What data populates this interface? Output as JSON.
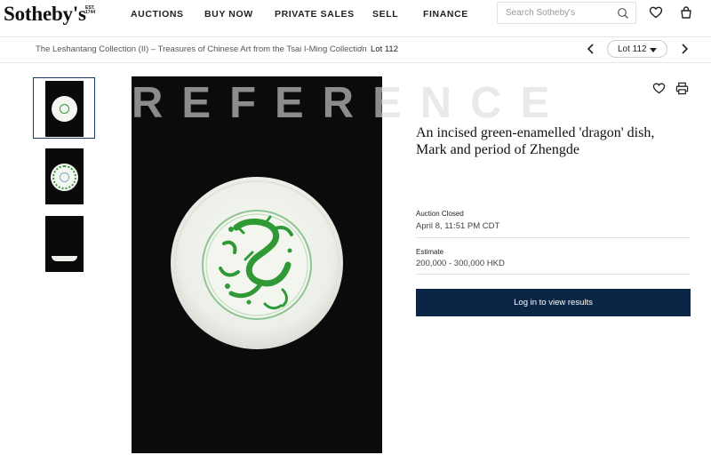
{
  "header": {
    "logo": "Sotheby's",
    "logo_est": "EST. 1744",
    "nav": [
      "AUCTIONS",
      "BUY NOW",
      "PRIVATE SALES",
      "SELL",
      "FINANCE"
    ],
    "search_placeholder": "Search Sotheby's",
    "icons": [
      "search-icon",
      "heart-icon",
      "bag-icon"
    ]
  },
  "breadcrumb": {
    "collection": "The Leshantang Collection (II) – Treasures of Chinese Art from the Tsai I-Ming Collection",
    "separator": "/",
    "current": "Lot 112",
    "lot_selector": "Lot 112"
  },
  "gallery": {
    "watermark": "REFERENCE",
    "thumbnails": [
      "front",
      "back",
      "side"
    ],
    "selected_thumbnail": 0
  },
  "lot": {
    "title_line1": "An incised green-enamelled 'dragon' dish,",
    "title_line2": "Mark and period of Zhengde",
    "status_label": "Auction Closed",
    "status_value": "April 8, 11:51 PM CDT",
    "estimate_label": "Estimate",
    "estimate_value": "200,000 - 300,000 HKD",
    "cta": "Log in to view results"
  },
  "colors": {
    "accent": "#0b2645",
    "image_bg": "#0b0b0b",
    "dragon_green": "#2f9a35"
  }
}
